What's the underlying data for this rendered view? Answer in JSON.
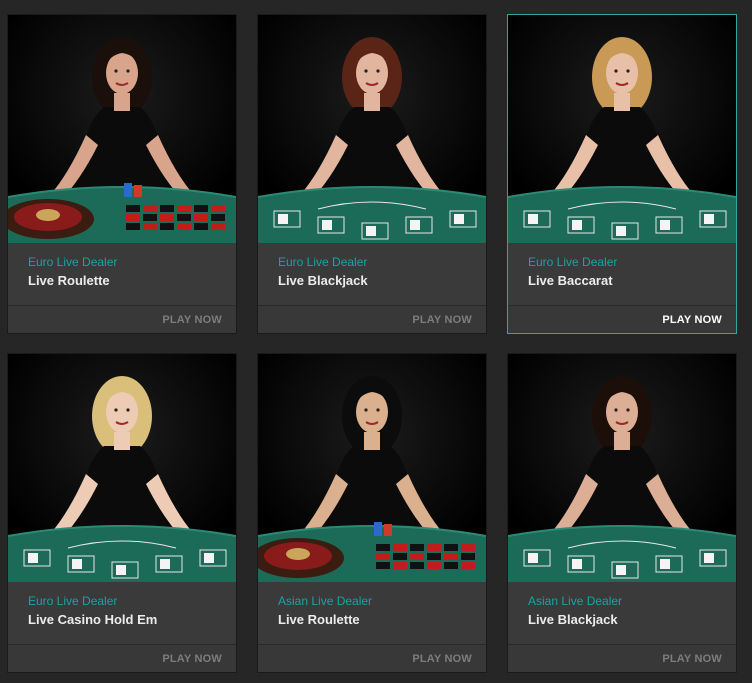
{
  "games": [
    {
      "category": "Euro Live Dealer",
      "title": "Live Roulette",
      "cta": "PLAY NOW",
      "table": "roulette",
      "hair": "#1a0f0a",
      "skin": "#d8a58c",
      "active": false
    },
    {
      "category": "Euro Live Dealer",
      "title": "Live Blackjack",
      "cta": "PLAY NOW",
      "table": "blackjack",
      "hair": "#5a2416",
      "skin": "#e2b59e",
      "active": false
    },
    {
      "category": "Euro Live Dealer",
      "title": "Live Baccarat",
      "cta": "PLAY NOW",
      "table": "baccarat",
      "hair": "#c99a55",
      "skin": "#e8c0a8",
      "active": true
    },
    {
      "category": "Euro Live Dealer",
      "title": "Live Casino Hold Em",
      "cta": "PLAY NOW",
      "table": "holdem",
      "hair": "#d9bf7a",
      "skin": "#edcbb5",
      "active": false
    },
    {
      "category": "Asian Live Dealer",
      "title": "Live Roulette",
      "cta": "PLAY NOW",
      "table": "roulette",
      "hair": "#0c0c0c",
      "skin": "#dab08f",
      "active": false
    },
    {
      "category": "Asian Live Dealer",
      "title": "Live Blackjack",
      "cta": "PLAY NOW",
      "table": "blackjack",
      "hair": "#1c0f0a",
      "skin": "#dcae96",
      "active": false
    }
  ],
  "colors": {
    "accent": "#1aa3a3",
    "felt": "#1c6a58",
    "active_border": "#2fa6a6"
  }
}
